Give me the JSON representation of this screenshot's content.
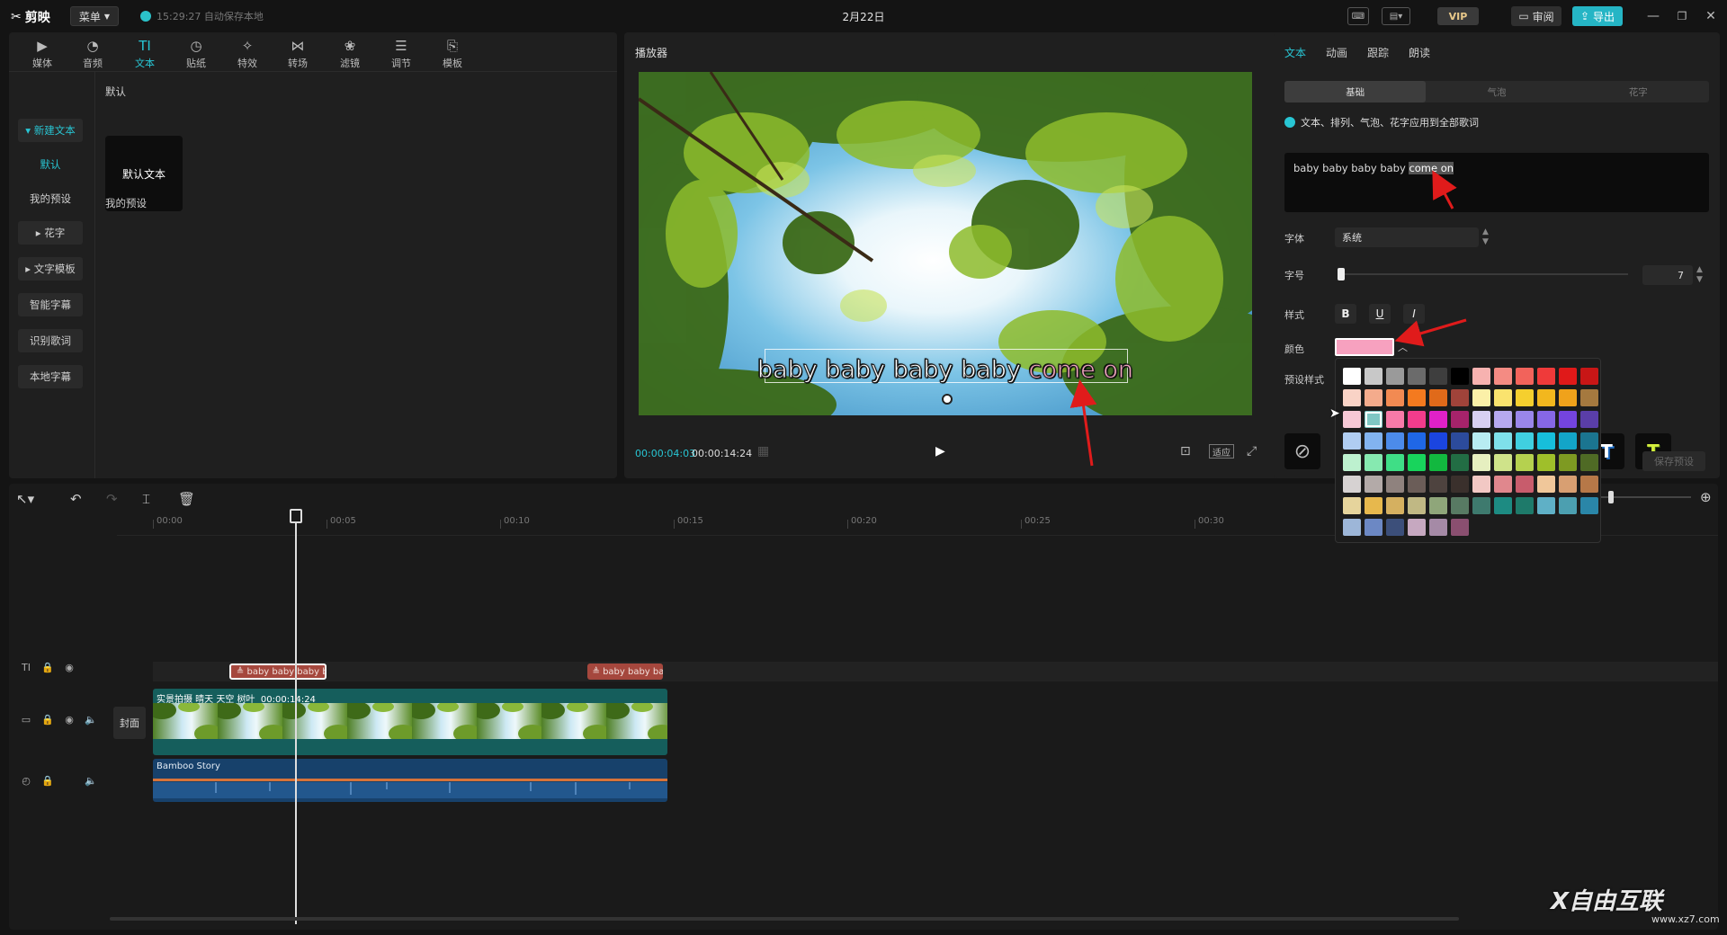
{
  "titlebar": {
    "app_name": "剪映",
    "menu_label": "菜单",
    "autosave_text": "15:29:27 自动保存本地",
    "doc_title": "2月22日",
    "vip_label": "VIP",
    "review_label": "审阅",
    "export_label": "导出"
  },
  "left_panel": {
    "tabs": [
      {
        "label": "媒体",
        "icon": "media-icon"
      },
      {
        "label": "音频",
        "icon": "audio-icon"
      },
      {
        "label": "文本",
        "icon": "text-icon"
      },
      {
        "label": "贴纸",
        "icon": "sticker-icon"
      },
      {
        "label": "特效",
        "icon": "effects-icon"
      },
      {
        "label": "转场",
        "icon": "transition-icon"
      },
      {
        "label": "滤镜",
        "icon": "filter-icon"
      },
      {
        "label": "调节",
        "icon": "adjust-icon"
      },
      {
        "label": "模板",
        "icon": "template-icon"
      }
    ],
    "categories": {
      "new_text": "新建文本",
      "default": "默认",
      "my_presets": "我的预设",
      "fancy": "花字",
      "text_template": "文字模板",
      "smart_caption": "智能字幕",
      "lyrics": "识别歌词",
      "local_caption": "本地字幕"
    },
    "content": {
      "section_default": "默认",
      "default_card": "默认文本",
      "section_presets": "我的预设"
    }
  },
  "player": {
    "title": "播放器",
    "caption_plain": "baby baby baby baby ",
    "caption_highlight": "come on",
    "time_current": "00:00:04:03",
    "time_total": "00:00:14:24",
    "fit_label": "适应"
  },
  "right_panel": {
    "tabs": [
      "文本",
      "动画",
      "跟踪",
      "朗读"
    ],
    "segments": [
      "基础",
      "气泡",
      "花字"
    ],
    "apply_all_label": "文本、排列、气泡、花字应用到全部歌词",
    "text_plain": "baby baby baby baby ",
    "text_selected": "come on",
    "font_label": "字体",
    "font_value": "系统",
    "size_label": "字号",
    "size_value": "7",
    "size_fraction": 0.01,
    "style_label": "样式",
    "color_label": "颜色",
    "current_color": "#f7a1bf",
    "preset_label": "预设样式",
    "save_preset_label": "保存预设"
  },
  "color_picker": {
    "selected_index": 25,
    "colors": [
      "#ffffff",
      "#c8c8c8",
      "#9a9a9a",
      "#6b6b6b",
      "#3e3e3e",
      "#000000",
      "#f7b2b0",
      "#f48b83",
      "#f2635b",
      "#ef3a3a",
      "#e01919",
      "#c81616",
      "#f9d3c6",
      "#f4ab8c",
      "#f28a52",
      "#f47a1f",
      "#e06a1a",
      "#a0433a",
      "#fbf0a8",
      "#fae36e",
      "#f5cf2e",
      "#f2b71e",
      "#f0a21b",
      "#a5793f",
      "#f7c8d6",
      "#7fc7c4",
      "#f77aa8",
      "#f23c8c",
      "#e021c8",
      "#a6236b",
      "#d8d0f2",
      "#b7a9ef",
      "#9a86ea",
      "#8667e6",
      "#7444de",
      "#5a3ea8",
      "#b0cdf2",
      "#82b3ef",
      "#4c8bea",
      "#1f67e6",
      "#1b45e0",
      "#2c4b9c",
      "#b8ecf2",
      "#7fe0ea",
      "#40cfe0",
      "#17bedb",
      "#13a5c8",
      "#1b7590",
      "#bdf1cf",
      "#86e9b0",
      "#3fde86",
      "#18d45c",
      "#12b83f",
      "#226d44",
      "#e6efc0",
      "#cfe38a",
      "#b5d14f",
      "#9fbf2a",
      "#7e9a22",
      "#4f6a25",
      "#d6d2d2",
      "#b3aaa8",
      "#8f827e",
      "#6b5d58",
      "#4e433f",
      "#3a302c",
      "#f2c8c4",
      "#e0878d",
      "#c85c6c",
      "#f0c79a",
      "#d89f72",
      "#b67848",
      "#e6d49c",
      "#e7b84d",
      "#d5b060",
      "#c0b884",
      "#8fa67a",
      "#587a63",
      "#3e7a6e",
      "#1d8b82",
      "#1e7a6a",
      "#5fb0c6",
      "#4c9fb0",
      "#2a86a8",
      "#9db6d8",
      "#6c88c4",
      "#3c4f7a",
      "#c6a8c0",
      "#a58aa6",
      "#8a4f70"
    ]
  },
  "timeline": {
    "ruler_labels": [
      "00:00",
      "00:05",
      "00:10",
      "00:15",
      "00:20",
      "00:25",
      "00:30"
    ],
    "playhead_seconds": 4.1,
    "text_clips": [
      {
        "label": "baby baby baby b",
        "start": 2.2,
        "end": 5.0
      },
      {
        "label": "baby baby ba",
        "start": 12.5,
        "end": 14.7
      }
    ],
    "cover_label": "封面",
    "video_clip_label": "实景拍摄 晴天 天空 树叶",
    "video_clip_duration": "00:00:14:24",
    "audio_clip_label": "Bamboo Story"
  },
  "watermark": {
    "logo_text": "X自由互联",
    "url": "www.xz7.com"
  }
}
